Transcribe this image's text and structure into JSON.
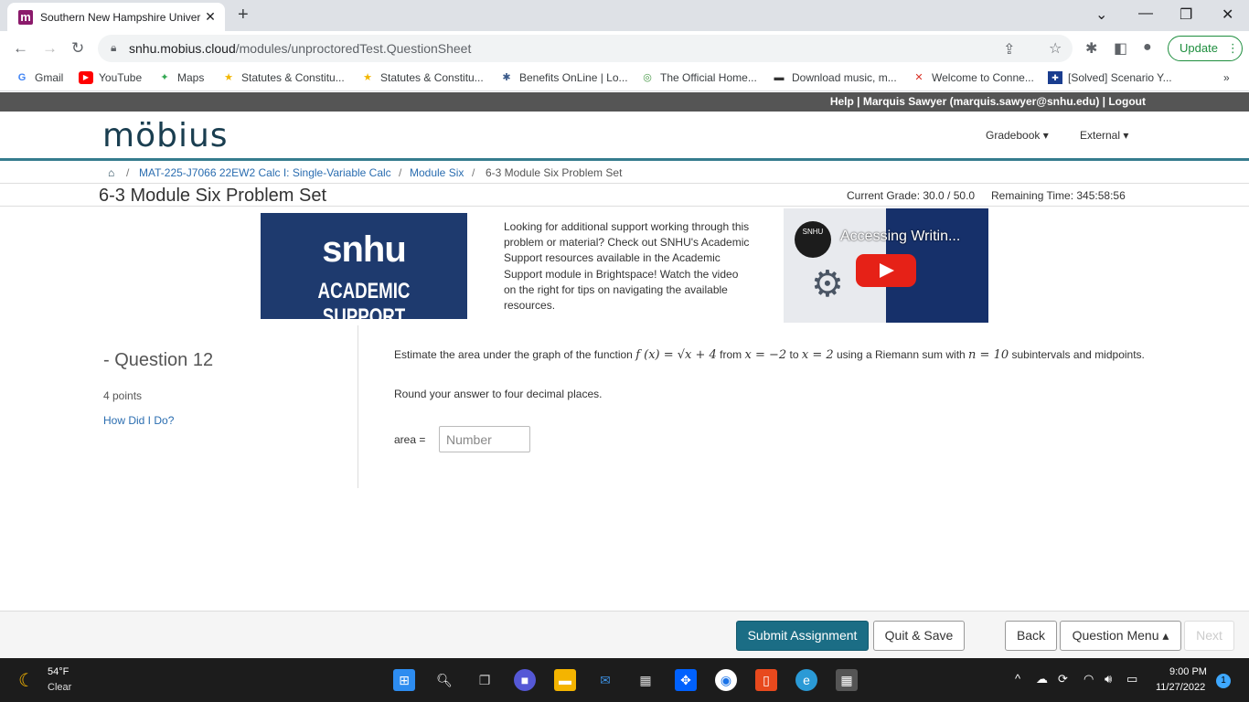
{
  "browser": {
    "tab_title": "Southern New Hampshire Univer",
    "tab_favicon": "m",
    "url_host": "snhu.mobius.cloud",
    "url_path": "/modules/unproctoredTest.QuestionSheet",
    "update_label": "Update",
    "bookmarks": [
      {
        "label": "Gmail",
        "icon": "G"
      },
      {
        "label": "YouTube",
        "icon": "▶"
      },
      {
        "label": "Maps",
        "icon": "✦"
      },
      {
        "label": "Statutes & Constitu...",
        "icon": "★"
      },
      {
        "label": "Statutes & Constitu...",
        "icon": "★"
      },
      {
        "label": "Benefits OnLine | Lo...",
        "icon": "✱"
      },
      {
        "label": "The Official Home...",
        "icon": "◎"
      },
      {
        "label": "Download music, m...",
        "icon": "▬"
      },
      {
        "label": "Welcome to Conne...",
        "icon": "✕"
      },
      {
        "label": "[Solved] Scenario Y...",
        "icon": "✚"
      }
    ]
  },
  "mobius": {
    "userbar": "Help | Marquis Sawyer (marquis.sawyer@snhu.edu) | Logout",
    "logo": "möbius",
    "menu_gradebook": "Gradebook",
    "menu_external": "External",
    "breadcrumb": {
      "course": "MAT-225-J7066 22EW2 Calc I: Single-Variable Calc",
      "module": "Module Six",
      "current": "6-3 Module Six Problem Set"
    },
    "page_title": "6-3 Module Six Problem Set",
    "current_grade": "Current Grade: 30.0 / 50.0",
    "remaining_time": "Remaining Time:  345:58:56"
  },
  "support": {
    "banner_word": "snhu",
    "banner_sub": "ACADEMIC SUPPORT",
    "text": "Looking for additional support working through this problem or material? Check out SNHU's Academic Support resources available in the Academic Support module in Brightspace! Watch the video on the right for tips on navigating the available resources.",
    "video_title": "Accessing Writin...",
    "video_badge": "SNHU"
  },
  "question": {
    "heading": "- Question 12",
    "points": "4 points",
    "how_did_i_do": "How Did I Do?",
    "prompt_start": "Estimate the area under the graph of the function",
    "fx": "f (x) = √x + 4",
    "from": "from",
    "x_from": "x = −2",
    "to": "to",
    "x_to": "x = 2",
    "using": "using a Riemann sum with",
    "n": "n = 10",
    "prompt_end": "subintervals and midpoints.",
    "round_text": "Round your answer to four decimal places.",
    "area_label": "area =",
    "area_placeholder": "Number"
  },
  "footer": {
    "submit": "Submit Assignment",
    "quit_save": "Quit & Save",
    "back": "Back",
    "question_menu": "Question Menu ▴",
    "next": "Next"
  },
  "taskbar": {
    "temp": "54°F",
    "weather": "Clear",
    "time": "9:00 PM",
    "date": "11/27/2022",
    "notifications": "1"
  },
  "colors": {
    "accent": "#1b6d85",
    "header_border": "#367c8e",
    "snhu_blue": "#1e3a6e"
  }
}
